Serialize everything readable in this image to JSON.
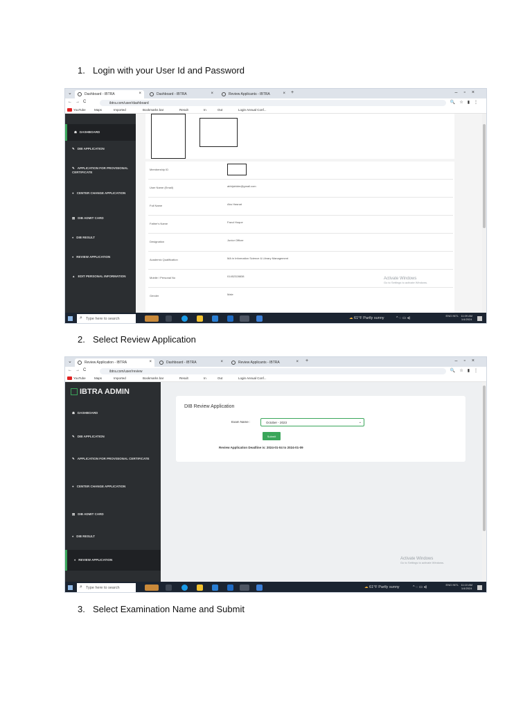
{
  "steps": [
    {
      "num": "1.",
      "text": "Login with your User Id and Password"
    },
    {
      "num": "2.",
      "text": "Select Review Application"
    },
    {
      "num": "3.",
      "text": "Select Examination Name and Submit"
    }
  ],
  "bookmarks": [
    "YouTube",
    "Maps",
    "Imported",
    "Bookmarks bar",
    "Result",
    "In",
    "Out",
    "Login Annual Conf..."
  ],
  "shot1": {
    "tabs": [
      "Dashboard - IBTRA",
      "Dashboard - IBTRA",
      "Review Applicants - IBTRA"
    ],
    "url": "ibtra.com/user/dashboard",
    "sidebar": [
      "DASHBOARD",
      "DIB APPLICATION",
      "APPLICATION FOR PROVISIONAL CERTIFICATE",
      "CENTER CHANGE APPLICATION",
      "DIB ADMIT CARD",
      "DIB RESULT",
      "REVIEW APPLICATION",
      "EDIT PERSONAL INFORMATION"
    ],
    "fields": [
      {
        "label": "Membership ID",
        "value": ""
      },
      {
        "label": "User Name (Email)",
        "value": "abhijahidm@gmail.com"
      },
      {
        "label": "Full Name",
        "value": "Abu Hasnat"
      },
      {
        "label": "Father's Name",
        "value": "Fazul Hoque"
      },
      {
        "label": "Designation",
        "value": "Junior Officer"
      },
      {
        "label": "Academic Qualification",
        "value": "MA in Information Science & Library Management"
      },
      {
        "label": "Mobile / Personal No",
        "value": "01452328838"
      },
      {
        "label": "Gender",
        "value": "Male"
      }
    ]
  },
  "shot2": {
    "tabs": [
      "Review Application - IBTRA",
      "Dashboard - IBTRA",
      "Review Applicants - IBTRA"
    ],
    "url": "ibtra.com/user/review",
    "brand": "IBTRA ADMIN",
    "sidebar": [
      "DASHBOARD",
      "DIB APPLICATION",
      "APPLICATION FOR PROVISIONAL CERTIFICATE",
      "CENTER CHANGE APPLICATION",
      "DIB ADMIT CARD",
      "DIB RESULT",
      "REVIEW APPLICATION"
    ],
    "card_title": "DIB Review Application",
    "exam_label": "Exam Name :",
    "exam_value": "October - 2023",
    "submit": "Submit",
    "deadline": "Review Application Deadline is: 2024-01-04 to 2024-01-09"
  },
  "taskbar": {
    "search_placeholder": "Type here to search",
    "weather": "61°F Partly sunny",
    "lang": "ENG INTL",
    "time1": "11:09 AM",
    "time2": "11:10 AM",
    "date": "1/4/2024"
  },
  "watermark": {
    "title": "Activate Windows",
    "sub": "Go to Settings to activate Windows."
  }
}
